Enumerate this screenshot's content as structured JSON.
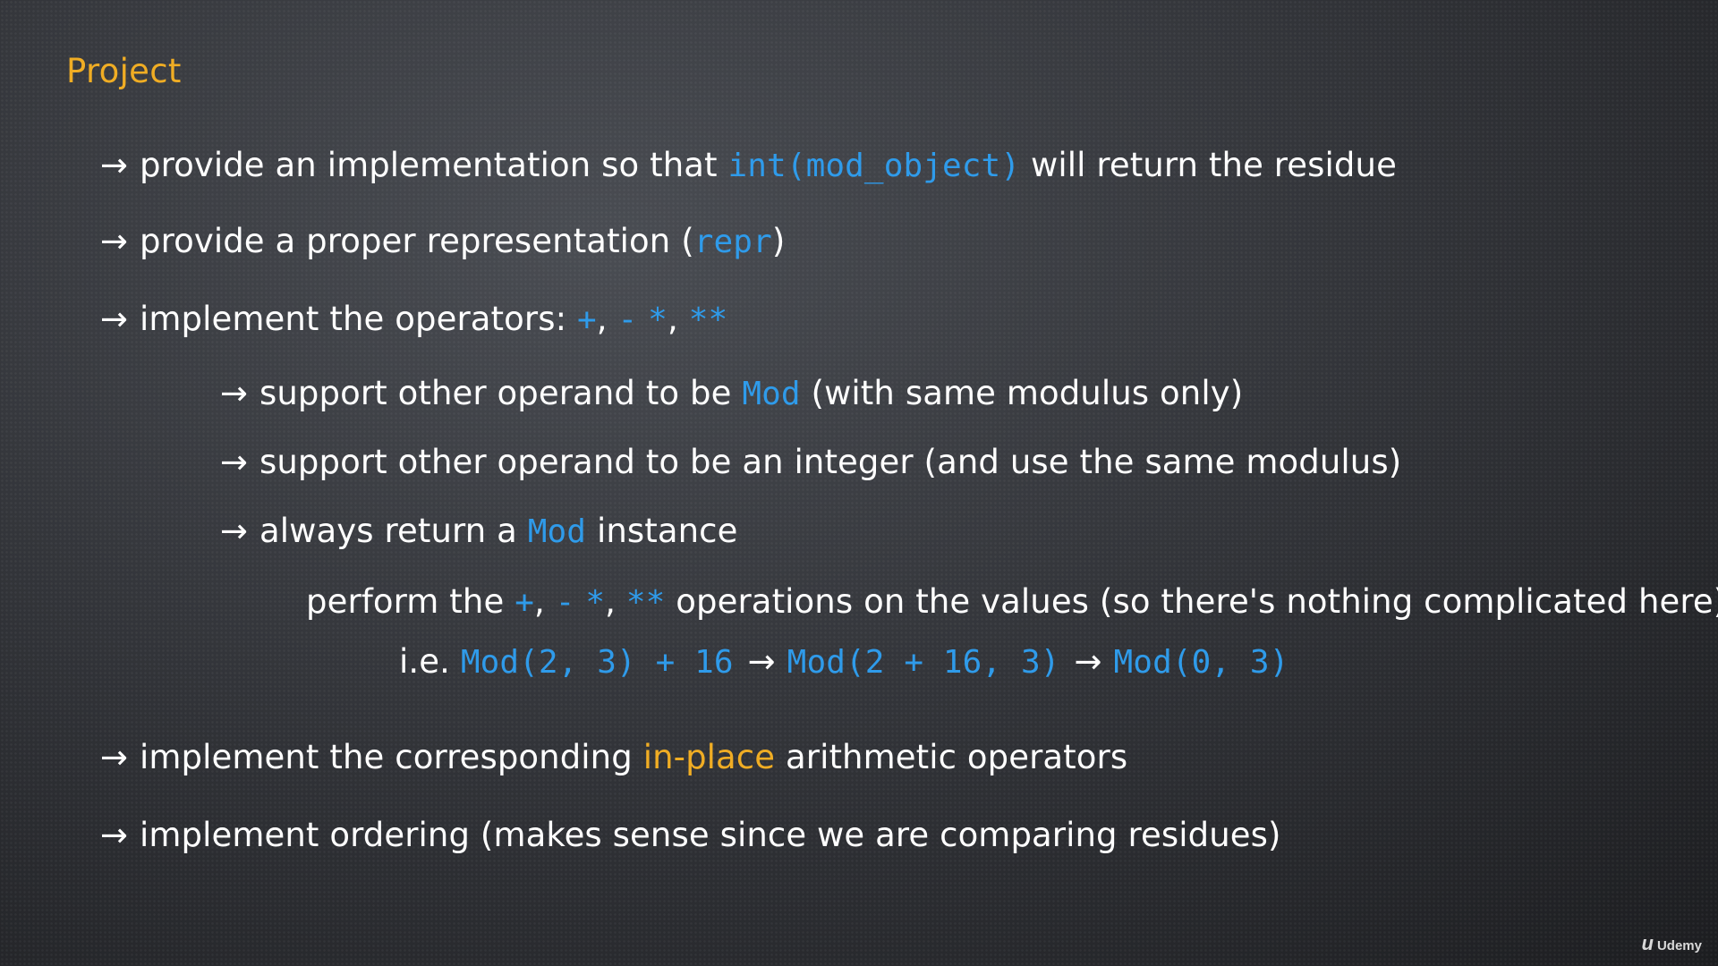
{
  "title": "Project",
  "arrow": "→",
  "bullets": {
    "b1": {
      "pre": "provide an implementation so that ",
      "code": "int(mod_object)",
      "post": " will return the residue"
    },
    "b2": {
      "pre": "provide a proper representation (",
      "code": "repr",
      "post": ")"
    },
    "b3": {
      "pre": "implement the operators: ",
      "op1": "+",
      "sep1": ", ",
      "op2": "-",
      "sep2": " ",
      "op3": "*",
      "sep3": ", ",
      "op4": "**"
    },
    "b4": {
      "pre": "support other operand to be ",
      "code": "Mod",
      "post": " (with same modulus only)"
    },
    "b5": {
      "text": "support other operand to be an integer (and use the same modulus)"
    },
    "b6": {
      "pre": "always return a ",
      "code": "Mod",
      "post": " instance"
    },
    "b7": {
      "pre": "perform the ",
      "op1": "+",
      "sep1": ", ",
      "op2": "-",
      "sep2": " ",
      "op3": "*",
      "sep3": ", ",
      "op4": "**",
      "post": "  operations on the values (so there's nothing complicated here)"
    },
    "b8": {
      "pre": "i.e. ",
      "code1": "Mod(2, 3) + 16",
      "code2": "Mod(2 + 16, 3)",
      "code3": "Mod(0, 3)"
    },
    "b9": {
      "pre": "implement the corresponding ",
      "highlight": "in-place",
      "post": " arithmetic operators"
    },
    "b10": {
      "text": "implement ordering (makes sense since we are comparing residues)"
    }
  },
  "brand": {
    "logo": "u",
    "name": "Udemy"
  },
  "colors": {
    "code": "#2f9bea",
    "accent": "#f0ad24",
    "text": "#ffffff"
  }
}
